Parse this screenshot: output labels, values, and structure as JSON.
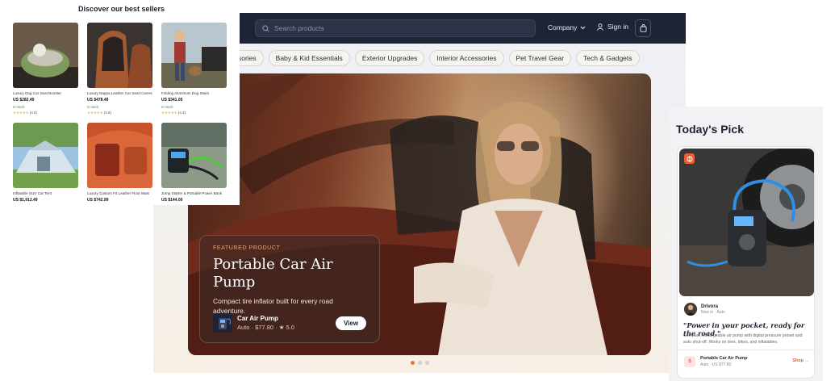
{
  "topbar": {
    "search_placeholder": "Search products",
    "company_label": "Company",
    "signin_label": "Sign in",
    "icons": [
      "search-icon",
      "chevron-down-icon",
      "user-icon",
      "bag-icon"
    ]
  },
  "categories": [
    {
      "label": "essories"
    },
    {
      "label": "Baby & Kid Essentials"
    },
    {
      "label": "Exterior Upgrades"
    },
    {
      "label": "Interior Accessories"
    },
    {
      "label": "Pet Travel Gear"
    },
    {
      "label": "Tech & Gadgets"
    }
  ],
  "hero": {
    "kicker": "FEATURED PRODUCT",
    "title": "Portable Car Air Pump",
    "description": "Compact tire inflator built for every road adventure.",
    "product_name": "Car Air Pump",
    "product_meta": "Auto · $77.80 · ★ 5.0",
    "view_label": "View",
    "carousel_active_index": 0,
    "carousel_count": 3
  },
  "best_sellers": {
    "title": "Discover our best sellers",
    "items": [
      {
        "name": "Luxury Dog Car Seat Booster",
        "price": "US $282.49",
        "stock": "In stock",
        "stars": "★★★★★",
        "count": "(4.5)"
      },
      {
        "name": "Luxury Nappa Leather Car Seat Covers",
        "price": "US $478.49",
        "stock": "In stock",
        "stars": "★★★★★",
        "count": "(4.8)"
      },
      {
        "name": "Folding Aluminum Dog Stairs",
        "price": "US $341.05",
        "stock": "In stock",
        "stars": "★★★★★",
        "count": "(4.3)"
      },
      {
        "name": "Inflatable SUV Car Tent",
        "price": "US $1,912.49",
        "stock": "",
        "stars": "",
        "count": ""
      },
      {
        "name": "Luxury Custom Fit Leather Floor Mats",
        "price": "US $742.99",
        "stock": "",
        "stars": "",
        "count": ""
      },
      {
        "name": "Jump Starter & Portable Power Bank",
        "price": "US $144.00",
        "stock": "",
        "stars": "",
        "count": ""
      }
    ]
  },
  "todays_pick": {
    "title": "Today's Pick",
    "author_name": "Drivora",
    "author_meta": "New in · Auto",
    "quote": "\"Power in your pocket, ready for the road.\"",
    "description": "Compact rechargeable air pump with digital pressure preset and auto shut-off. Works on tires, bikes, and inflatables.",
    "product_thumb_letter": "$",
    "product_name": "Portable Car Air Pump",
    "product_meta": "Auto · US $77.80",
    "shop_label": "Shop →"
  },
  "colors": {
    "topbar": "#1e2436",
    "accent": "#e0603a",
    "stock_green": "#2fa24a",
    "star": "#f4b53a"
  }
}
